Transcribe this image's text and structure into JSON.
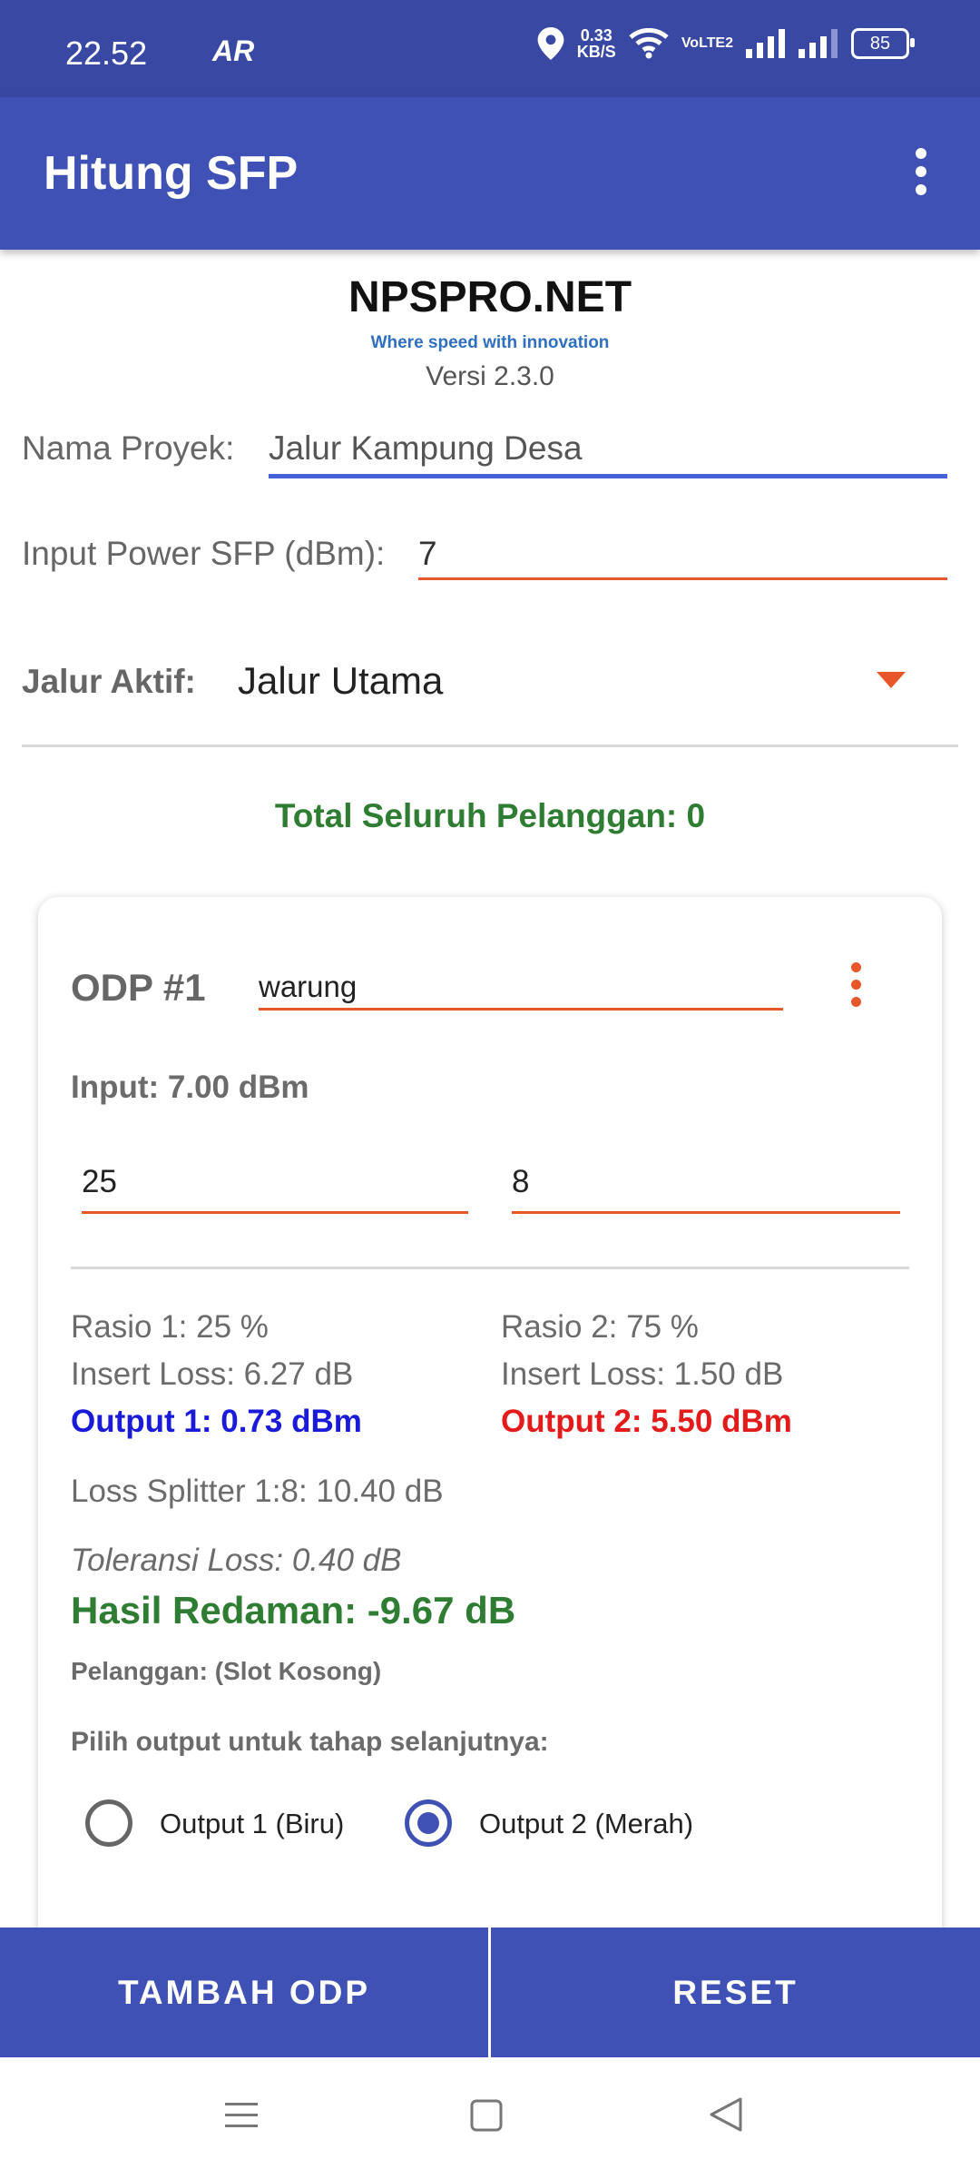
{
  "status_bar": {
    "time": "22.52",
    "ar_icon_text": "AR",
    "speed_value": "0.33",
    "speed_unit": "KB/S",
    "volte": "VoLTE2",
    "battery": "85"
  },
  "app_bar": {
    "title": "Hitung SFP",
    "menu_icon": "more-vert-icon"
  },
  "brand": {
    "name": "NPSPRO.NET",
    "tagline": "Where speed with innovation",
    "version": "Versi 2.3.0"
  },
  "form": {
    "project_label": "Nama Proyek:",
    "project_value": "Jalur Kampung Desa",
    "power_label": "Input Power SFP (dBm):",
    "power_value": "7",
    "path_label": "Jalur Aktif:",
    "path_value": "Jalur Utama"
  },
  "total_customers": "Total Seluruh Pelanggan: 0",
  "odp": {
    "title": "ODP #1",
    "name_value": "warung",
    "input_text": "Input: 7.00 dBm",
    "ratio_value": "25",
    "splitter_value": "8",
    "ratio1": "Rasio 1: 25 %",
    "insert_loss1": "Insert Loss: 6.27 dB",
    "output1": "Output 1: 0.73 dBm",
    "ratio2": "Rasio 2: 75 %",
    "insert_loss2": "Insert Loss: 1.50 dB",
    "output2": "Output 2: 5.50 dBm",
    "loss_splitter": "Loss Splitter 1:8: 10.40 dB",
    "tolerance": "Toleransi Loss: 0.40 dB",
    "result": "Hasil Redaman: -9.67 dB",
    "customers": "Pelanggan: (Slot Kosong)",
    "choose_output": "Pilih output untuk tahap selanjutnya:",
    "option1": "Output 1 (Biru)",
    "option2": "Output 2 (Merah)",
    "selected_option": "Output 2 (Merah)"
  },
  "buttons": {
    "add_odp": "TAMBAH ODP",
    "reset": "RESET"
  },
  "colors": {
    "primary": "#3f51b5",
    "accent": "#e8572a",
    "green": "#2e7d32",
    "blue_output": "#1a1ad9",
    "red_output": "#e31b1b"
  }
}
